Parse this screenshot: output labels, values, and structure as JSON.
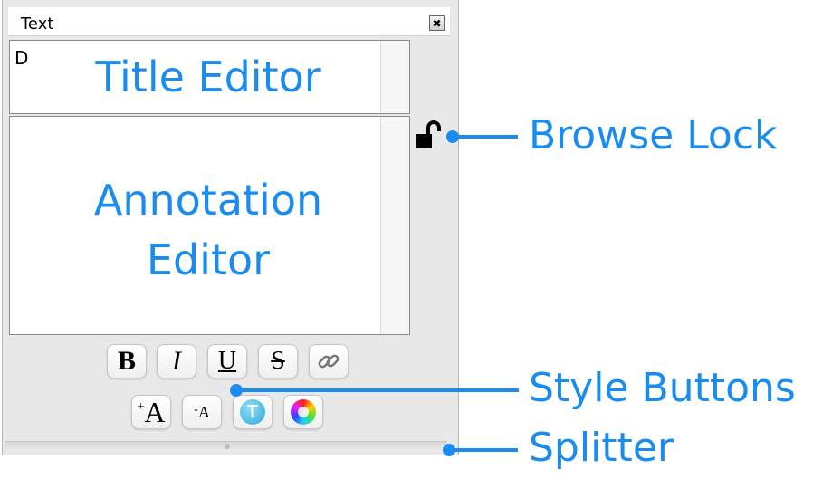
{
  "panel": {
    "title": "Text",
    "close_glyph": "✖",
    "title_editor_value": "D",
    "labels": {
      "title_editor": "Title Editor",
      "annotation_line1": "Annotation",
      "annotation_line2": "Editor"
    }
  },
  "style_buttons": {
    "row1": [
      {
        "name": "bold",
        "glyph": "B"
      },
      {
        "name": "italic",
        "glyph": "I"
      },
      {
        "name": "underline",
        "glyph": "U"
      },
      {
        "name": "strikethrough",
        "glyph": "S"
      },
      {
        "name": "link",
        "icon": "chain-link-icon"
      }
    ],
    "row2": [
      {
        "name": "increase-font",
        "glyph": "A",
        "prefix": "+"
      },
      {
        "name": "decrease-font",
        "glyph": "A",
        "prefix": "-"
      },
      {
        "name": "text-color-badge",
        "glyph": "T"
      },
      {
        "name": "color-wheel",
        "icon": "color-wheel-icon"
      }
    ]
  },
  "callouts": {
    "browse_lock": "Browse Lock",
    "style_buttons": "Style Buttons",
    "splitter": "Splitter"
  },
  "colors": {
    "accent": "#1a8cf0",
    "panel_bg": "#e8e8e8",
    "badge": "#3fb8e0"
  }
}
